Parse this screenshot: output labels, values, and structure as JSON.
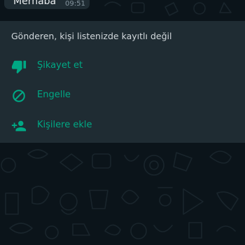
{
  "message": {
    "text": "Merhaba",
    "time": "09:51"
  },
  "unknown_sender_panel": {
    "notice": "Gönderen, kişi listenizde kayıtlı değil",
    "actions": [
      {
        "label": "Şikayet et",
        "icon": "thumbs-down-icon"
      },
      {
        "label": "Engelle",
        "icon": "block-icon"
      },
      {
        "label": "Kişilere ekle",
        "icon": "add-person-icon"
      }
    ]
  },
  "colors": {
    "background": "#0b141a",
    "panel": "#1f2c33",
    "accent": "#00a884",
    "text_primary": "#e9edef",
    "text_secondary": "#8696a0"
  }
}
